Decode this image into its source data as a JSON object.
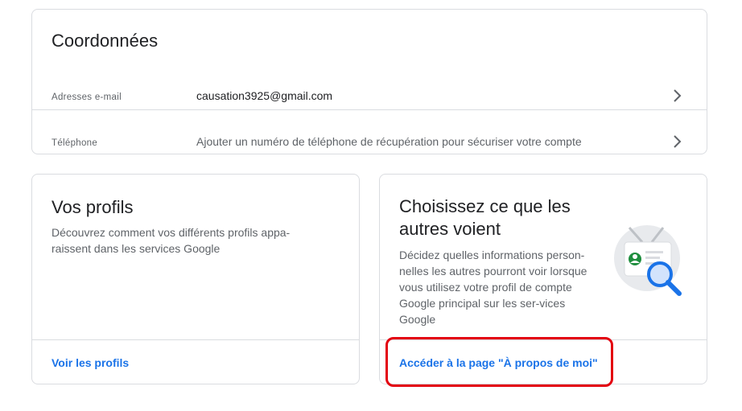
{
  "contact": {
    "title": "Coordonnées",
    "email": {
      "label": "Adresses e-mail",
      "value": "causation3925@gmail.com"
    },
    "phone": {
      "label": "Téléphone",
      "value": "Ajouter un numéro de téléphone de récupération pour sécuriser votre compte"
    }
  },
  "profiles": {
    "title": "Vos profils",
    "description": "Découvrez comment vos différents profils appa-raissent dans les services Google",
    "link": "Voir les profils"
  },
  "about": {
    "title": "Choisissez ce que les autres voient",
    "description": "Décidez quelles informations person-nelles les autres pourront voir lorsque vous utilisez votre profil de compte Google principal sur les ser-vices Google",
    "link": "Accéder à la page \"À propos de moi\""
  },
  "colors": {
    "accent": "#1a73e8",
    "highlight": "#e3000f",
    "border": "#dadce0"
  }
}
